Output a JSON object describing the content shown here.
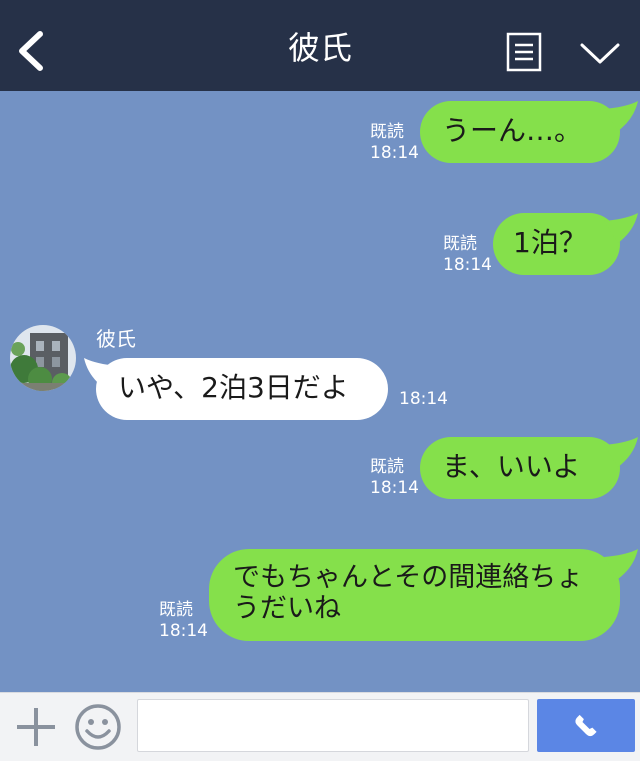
{
  "header": {
    "title": "彼氏",
    "back_icon": "chevron-left-icon",
    "menu_icon": "note-icon",
    "expand_icon": "chevron-down-icon",
    "background": "#263148"
  },
  "chat": {
    "background": "#7392c4",
    "sent_bubble_color": "#85e04b",
    "received_bubble_color": "#ffffff",
    "messages": [
      {
        "side": "sent",
        "text": "うーん…。",
        "read": "既読",
        "time": "18:14"
      },
      {
        "side": "sent",
        "text": "1泊？",
        "read": "既読",
        "time": "18:14"
      },
      {
        "side": "received",
        "sender": "彼氏",
        "text": "いや、2泊3日だよ",
        "time": "18:14"
      },
      {
        "side": "sent",
        "text": "ま、いいよ",
        "read": "既読",
        "time": "18:14"
      },
      {
        "side": "sent",
        "text": "でもちゃんとその間連絡ちょうだいね",
        "read": "既読",
        "time": "18:14"
      }
    ]
  },
  "input_bar": {
    "add_icon": "plus-icon",
    "emoji_icon": "smiley-icon",
    "message_value": "",
    "call_icon": "phone-icon",
    "call_color": "#5b86e5"
  }
}
